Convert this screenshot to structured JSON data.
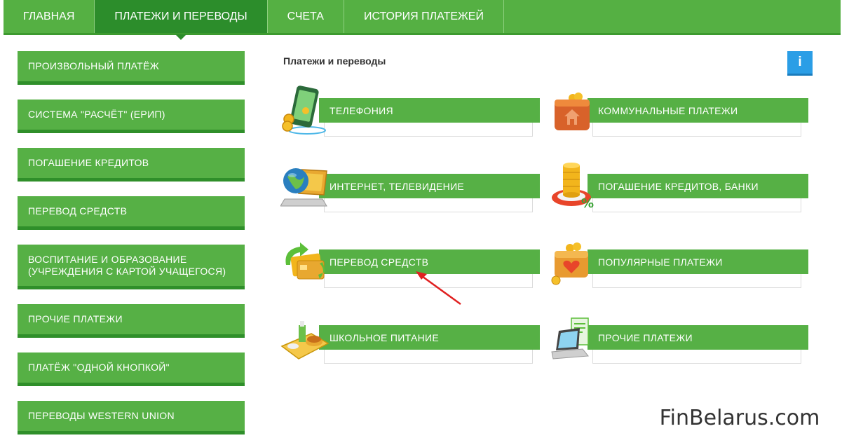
{
  "topnav": {
    "tabs": [
      {
        "label": "ГЛАВНАЯ"
      },
      {
        "label": "ПЛАТЕЖИ И ПЕРЕВОДЫ"
      },
      {
        "label": "СЧЕТА"
      },
      {
        "label": "ИСТОРИЯ ПЛАТЕЖЕЙ"
      }
    ],
    "active_tab": "ПЛАТЕЖИ И ПЕРЕВОДЫ"
  },
  "sidebar": {
    "items": [
      {
        "label": "ПРОИЗВОЛЬНЫЙ ПЛАТЁЖ"
      },
      {
        "label": "СИСТЕМА \"РАСЧЁТ\" (ЕРИП)"
      },
      {
        "label": "ПОГАШЕНИЕ КРЕДИТОВ"
      },
      {
        "label": "ПЕРЕВОД СРЕДСТВ"
      },
      {
        "label": "ВОСПИТАНИЕ И ОБРАЗОВАНИЕ (УЧРЕЖДЕНИЯ С КАРТОЙ УЧАЩЕГОСЯ)"
      },
      {
        "label": "ПРОЧИЕ ПЛАТЕЖИ"
      },
      {
        "label": "ПЛАТЁЖ \"ОДНОЙ КНОПКОЙ\""
      },
      {
        "label": "ПЕРЕВОДЫ WESTERN UNION"
      }
    ]
  },
  "main": {
    "title": "Платежи и переводы",
    "info_label": "i",
    "cards": [
      {
        "label": "ТЕЛЕФОНИЯ",
        "icon": "phone-coins-icon"
      },
      {
        "label": "КОММУНАЛЬНЫЕ ПЛАТЕЖИ",
        "icon": "wallet-house-icon"
      },
      {
        "label": "ИНТЕРНЕТ, ТЕЛЕВИДЕНИЕ",
        "icon": "globe-laptop-icon"
      },
      {
        "label": "ПОГАШЕНИЕ КРЕДИТОВ, БАНКИ",
        "icon": "coins-percent-icon"
      },
      {
        "label": "ПЕРЕВОД СРЕДСТВ",
        "icon": "card-transfer-icon"
      },
      {
        "label": "ПОПУЛЯРНЫЕ ПЛАТЕЖИ",
        "icon": "wallet-heart-icon"
      },
      {
        "label": "ШКОЛЬНОЕ ПИТАНИЕ",
        "icon": "food-tray-icon"
      },
      {
        "label": "ПРОЧИЕ ПЛАТЕЖИ",
        "icon": "laptop-receipt-icon"
      }
    ]
  },
  "watermark": "FinBelarus.com",
  "colors": {
    "green": "#56b045",
    "dark_green": "#2c8d2b",
    "info_blue": "#2b9ee6",
    "arrow_red": "#e02020"
  }
}
